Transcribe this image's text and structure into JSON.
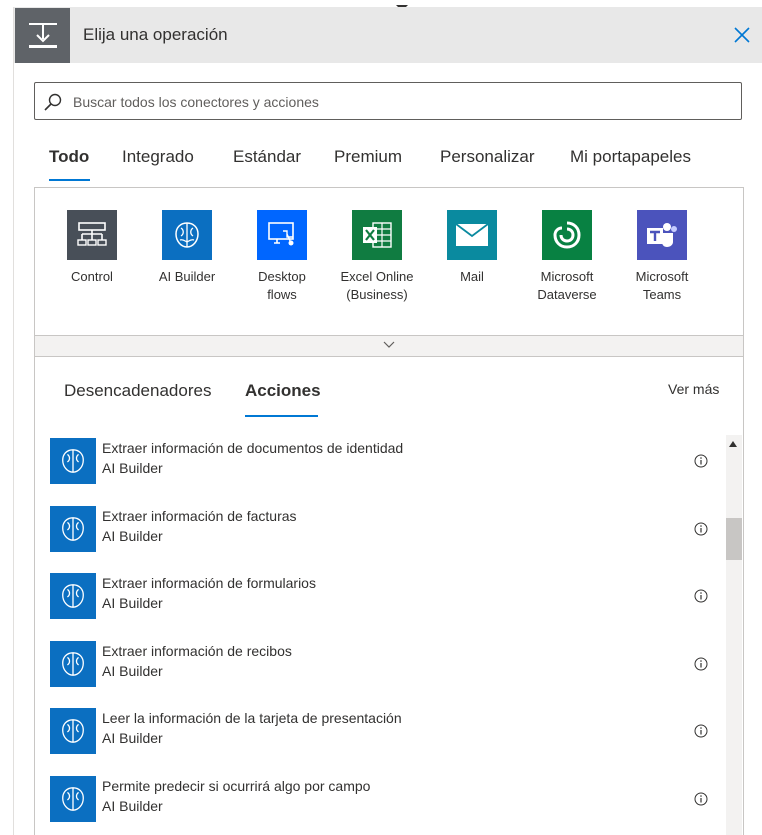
{
  "header": {
    "title": "Elija una operación",
    "close_label": "close"
  },
  "search": {
    "placeholder": "Buscar todos los conectores y acciones",
    "value": ""
  },
  "tabs": [
    {
      "label": "Todo",
      "active": true
    },
    {
      "label": "Integrado",
      "active": false
    },
    {
      "label": "Estándar",
      "active": false
    },
    {
      "label": "Premium",
      "active": false
    },
    {
      "label": "Personalizar",
      "active": false
    },
    {
      "label": "Mi portapapeles",
      "active": false
    }
  ],
  "connectors": [
    {
      "line1": "Control",
      "line2": "",
      "icon": "control-icon",
      "color": "#484f58"
    },
    {
      "line1": "AI Builder",
      "line2": "",
      "icon": "ai-builder-icon",
      "color": "#0b6fc1"
    },
    {
      "line1": "Desktop",
      "line2": "flows",
      "icon": "desktop-flows-icon",
      "color": "#0066ff"
    },
    {
      "line1": "Excel Online",
      "line2": "(Business)",
      "icon": "excel-icon",
      "color": "#107c41"
    },
    {
      "line1": "Mail",
      "line2": "",
      "icon": "mail-icon",
      "color": "#0a8a9f"
    },
    {
      "line1": "Microsoft",
      "line2": "Dataverse",
      "icon": "dataverse-icon",
      "color": "#088142"
    },
    {
      "line1": "Microsoft",
      "line2": "Teams",
      "icon": "teams-icon",
      "color": "#4b53bc"
    }
  ],
  "results": {
    "tabs": [
      {
        "label": "Desencadenadores",
        "active": false
      },
      {
        "label": "Acciones",
        "active": true
      }
    ],
    "see_more": "Ver más",
    "actions": [
      {
        "title": "Extraer información de documentos de identidad",
        "connector": "AI Builder"
      },
      {
        "title": "Extraer información de facturas",
        "connector": "AI Builder"
      },
      {
        "title": "Extraer información de formularios",
        "connector": "AI Builder"
      },
      {
        "title": "Extraer información de recibos",
        "connector": "AI Builder"
      },
      {
        "title": "Leer la información de la tarjeta de presentación",
        "connector": "AI Builder"
      },
      {
        "title": "Permite predecir si ocurrirá algo por campo",
        "connector": "AI Builder"
      }
    ]
  },
  "colors": {
    "accent": "#0078d4",
    "header_bg": "#e8e8e8",
    "ai_builder": "#0b6fc1"
  }
}
